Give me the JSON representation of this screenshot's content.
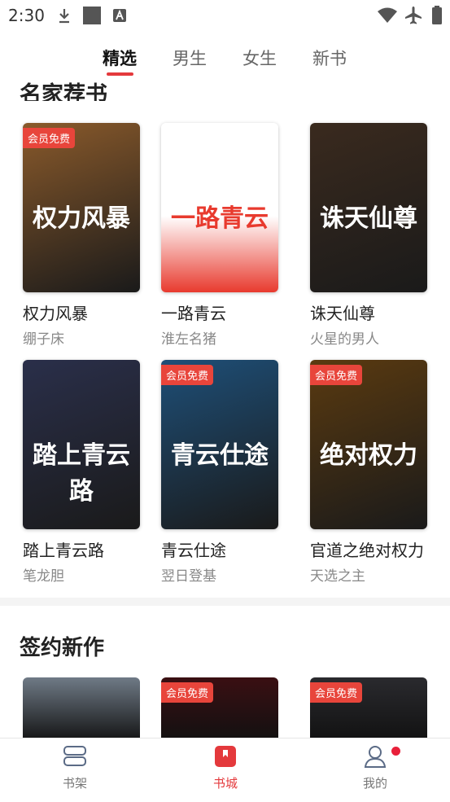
{
  "status_bar": {
    "time": "2:30"
  },
  "tabs": [
    {
      "label": "精选",
      "active": true
    },
    {
      "label": "男生",
      "active": false
    },
    {
      "label": "女生",
      "active": false
    },
    {
      "label": "新书",
      "active": false
    }
  ],
  "sections": {
    "partial_title": "名家荐书",
    "new_title": "签约新作"
  },
  "books": [
    {
      "title": "权力风暴",
      "author": "绷子床",
      "badge": "会员免费",
      "cover_text": "权力风暴",
      "cover_color": "#8a5a2b"
    },
    {
      "title": "一路青云",
      "author": "淮左名猪",
      "badge": "",
      "cover_text": "一路青云",
      "cover_color": "#e83a2e"
    },
    {
      "title": "诛天仙尊",
      "author": "火星的男人",
      "badge": "",
      "cover_text": "诛天仙尊",
      "cover_color": "#3a2a1e"
    },
    {
      "title": "踏上青云路",
      "author": "笔龙胆",
      "badge": "",
      "cover_text": "踏上青云路",
      "cover_color": "#2a2f4a"
    },
    {
      "title": "青云仕途",
      "author": "翌日登基",
      "badge": "会员免费",
      "cover_text": "青云仕途",
      "cover_color": "#1e4f78"
    },
    {
      "title": "官道之绝对权力",
      "author": "天选之主",
      "badge": "会员免费",
      "cover_text": "绝对权力",
      "cover_color": "#5a3a10"
    }
  ],
  "new_books": [
    {
      "badge": "",
      "cover_color": "#6f7a86"
    },
    {
      "badge": "会员免费",
      "cover_color": "#3a0f12"
    },
    {
      "badge": "会员免费",
      "cover_color": "#2a2a2e"
    }
  ],
  "bottom_nav": [
    {
      "label": "书架",
      "active": false,
      "icon": "bookshelf-icon"
    },
    {
      "label": "书城",
      "active": true,
      "icon": "bookstore-icon"
    },
    {
      "label": "我的",
      "active": false,
      "icon": "profile-icon"
    }
  ],
  "colors": {
    "accent": "#e4393c",
    "badge": "#e8453b"
  }
}
